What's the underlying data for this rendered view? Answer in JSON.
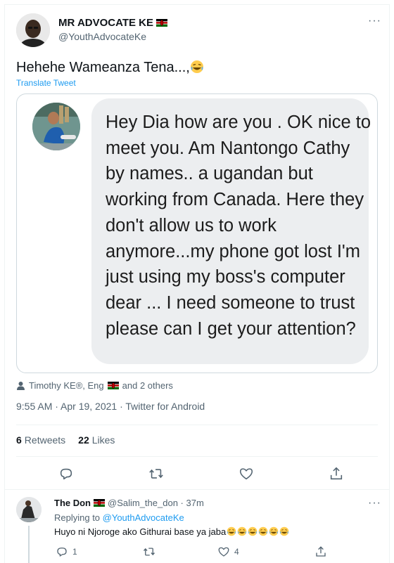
{
  "tweet": {
    "author_name": "MR ADVOCATE KE",
    "author_handle": "@YouthAdvocateKe",
    "text": "Hehehe Wameanza Tena...,",
    "translate": "Translate Tweet",
    "more": "···",
    "media": {
      "message": "Hey Dia how are you . OK nice to meet you. Am Nantongo Cathy by names.. a ugandan but working from Canada. Here they don't allow us to work anymore...my phone got lost  I'm just using my boss's computer dear ... I need someone to trust please can I get your attention?"
    },
    "tagged_prefix": "Timothy KE®, Eng",
    "tagged_suffix": "and 2 others",
    "timestamp": "9:55 AM · Apr 19, 2021 · Twitter for Android",
    "retweets_count": "6",
    "retweets_label": "Retweets",
    "likes_count": "22",
    "likes_label": "Likes"
  },
  "reply": {
    "author_name": "The Don",
    "author_handle": "@Salim_the_don · 37m",
    "replying_label": "Replying to ",
    "replying_to": "@YouthAdvocateKe",
    "text": "Huyo ni Njoroge ako Githurai base ya jaba",
    "reply_count": "1",
    "like_count": "4",
    "more": "···"
  },
  "colors": {
    "accent": "#1d9bf0",
    "muted": "#536471",
    "bubble": "#eceef0",
    "border": "#cfd9de"
  },
  "icons": [
    "reply-icon",
    "retweet-icon",
    "like-icon",
    "share-icon",
    "kenya-flag-icon",
    "laughing-emoji-icon",
    "tag-person-icon"
  ]
}
